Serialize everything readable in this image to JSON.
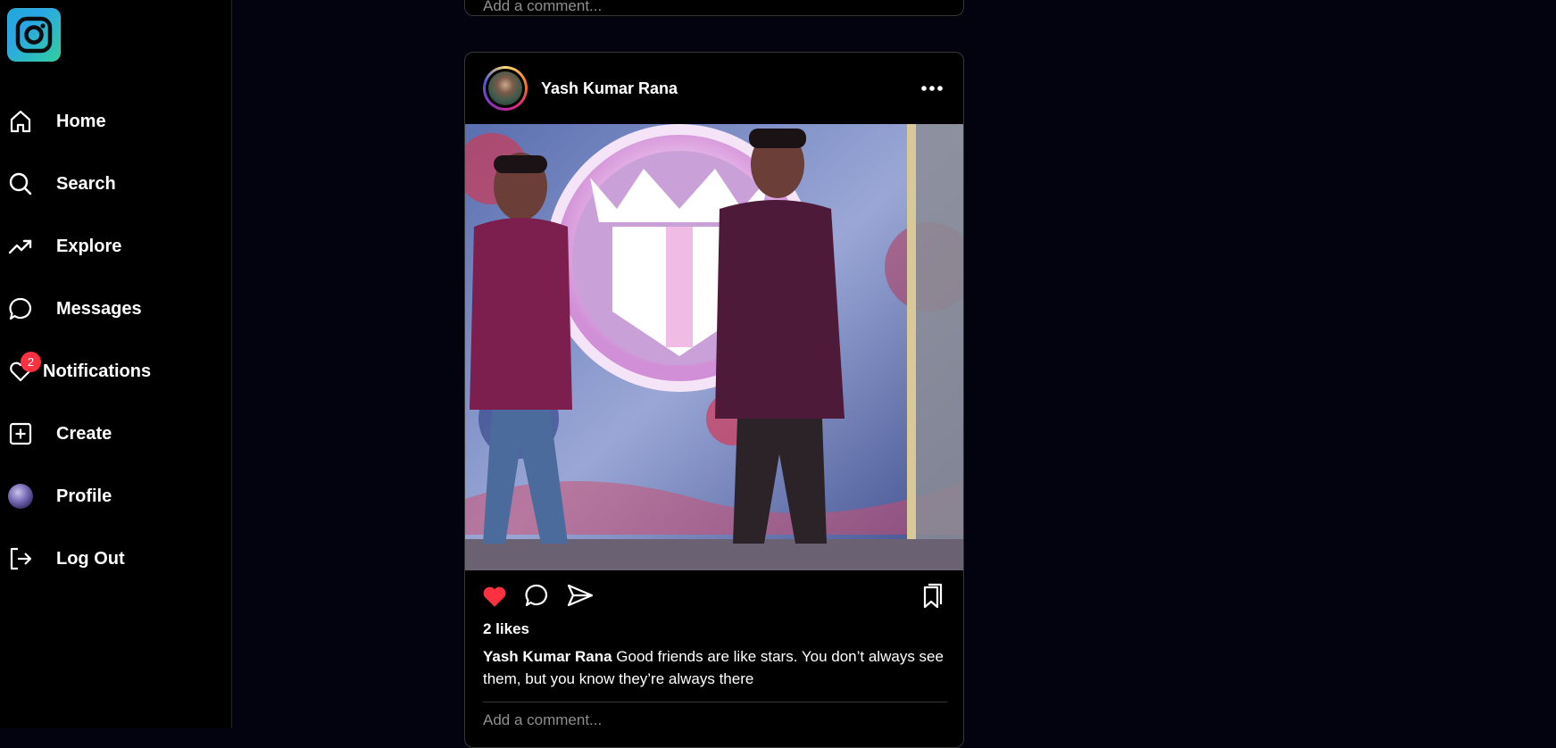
{
  "app": {
    "logo_icon": "instagram-logo-icon"
  },
  "sidebar": {
    "items": [
      {
        "label": "Home",
        "icon": "home-icon"
      },
      {
        "label": "Search",
        "icon": "search-icon"
      },
      {
        "label": "Explore",
        "icon": "trending-icon"
      },
      {
        "label": "Messages",
        "icon": "chat-bubble-icon"
      },
      {
        "label": "Notifications",
        "icon": "heart-icon",
        "badge": "2"
      },
      {
        "label": "Create",
        "icon": "plus-square-icon"
      },
      {
        "label": "Profile",
        "icon": "avatar"
      },
      {
        "label": "Log Out",
        "icon": "logout-icon"
      }
    ]
  },
  "previous_post": {
    "comment_placeholder": "Add a comment..."
  },
  "post": {
    "username": "Yash Kumar Rana",
    "likes": "2 likes",
    "liked": true,
    "caption_user": "Yash Kumar Rana",
    "caption_text": "Good friends are like stars. You don’t always see them, but you know they’re always there",
    "comment_placeholder": "Add a comment..."
  },
  "colors": {
    "background": "#03030f",
    "sidebar": "#000000",
    "like_red": "#ff3040",
    "border": "#363636",
    "placeholder": "#8e8e8e"
  }
}
